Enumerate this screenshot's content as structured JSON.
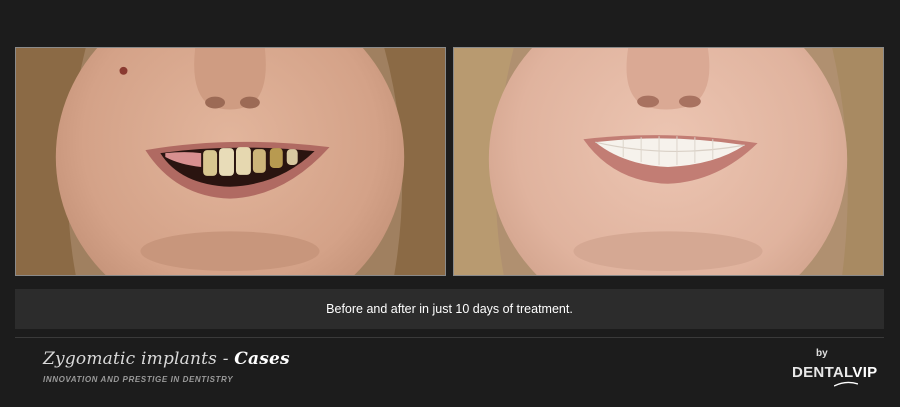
{
  "caption": "Before and after in just 10 days of treatment.",
  "footer": {
    "title_part1": "Zygomatic implants - ",
    "title_part2": "Cases",
    "tagline": "INNOVATION AND PRESTIGE IN DENTISTRY"
  },
  "brand": {
    "by": "by",
    "name_part1": "DENTAL",
    "name_part2": "VIP"
  },
  "colors": {
    "background": "#1c1c1c",
    "caption_bar": "#2c2c2c",
    "skin_before": "#d8a88e",
    "skin_after": "#e2b8a4",
    "hair": "#9a7a55"
  }
}
